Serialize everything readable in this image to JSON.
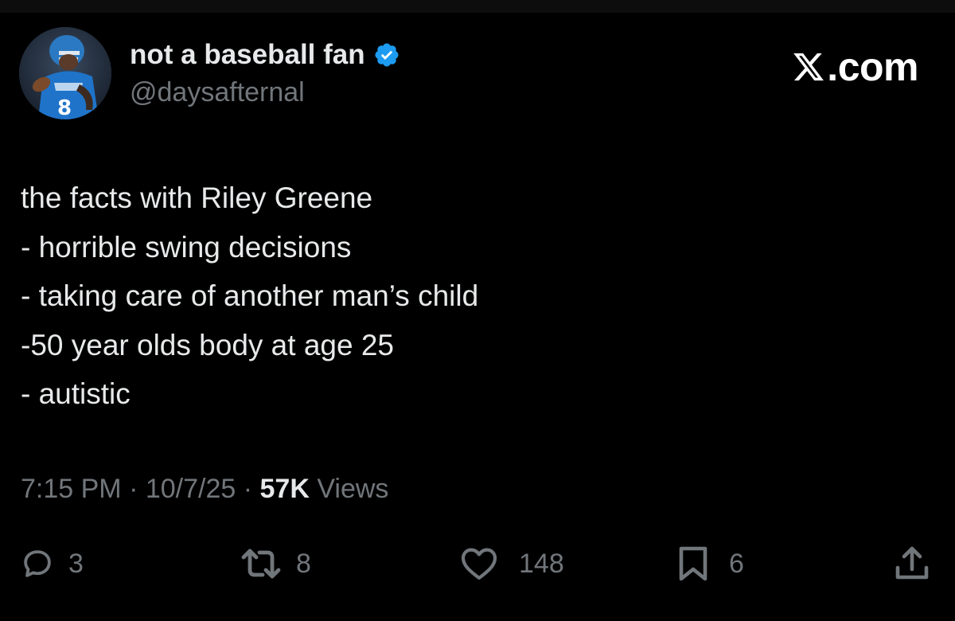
{
  "author": {
    "display_name": "not a baseball fan",
    "handle": "@daysafternal",
    "verified": true,
    "avatar_icon": "football-player-avatar"
  },
  "brand": {
    "label": ".com",
    "icon": "x-logo-icon"
  },
  "tweet": {
    "lines": [
      "the facts with Riley Greene",
      "- horrible swing decisions",
      "- taking care of another man’s child",
      "-50 year olds body at age 25",
      "- autistic"
    ]
  },
  "meta": {
    "time": "7:15 PM",
    "date": "10/7/25",
    "separator": " · ",
    "views_count": "57K",
    "views_label": " Views"
  },
  "actions": {
    "replies": "3",
    "reposts": "8",
    "likes": "148",
    "bookmarks": "6"
  },
  "colors": {
    "background": "#000000",
    "text": "#e7e9ea",
    "muted": "#71767b",
    "verified_blue": "#1d9bf0"
  }
}
